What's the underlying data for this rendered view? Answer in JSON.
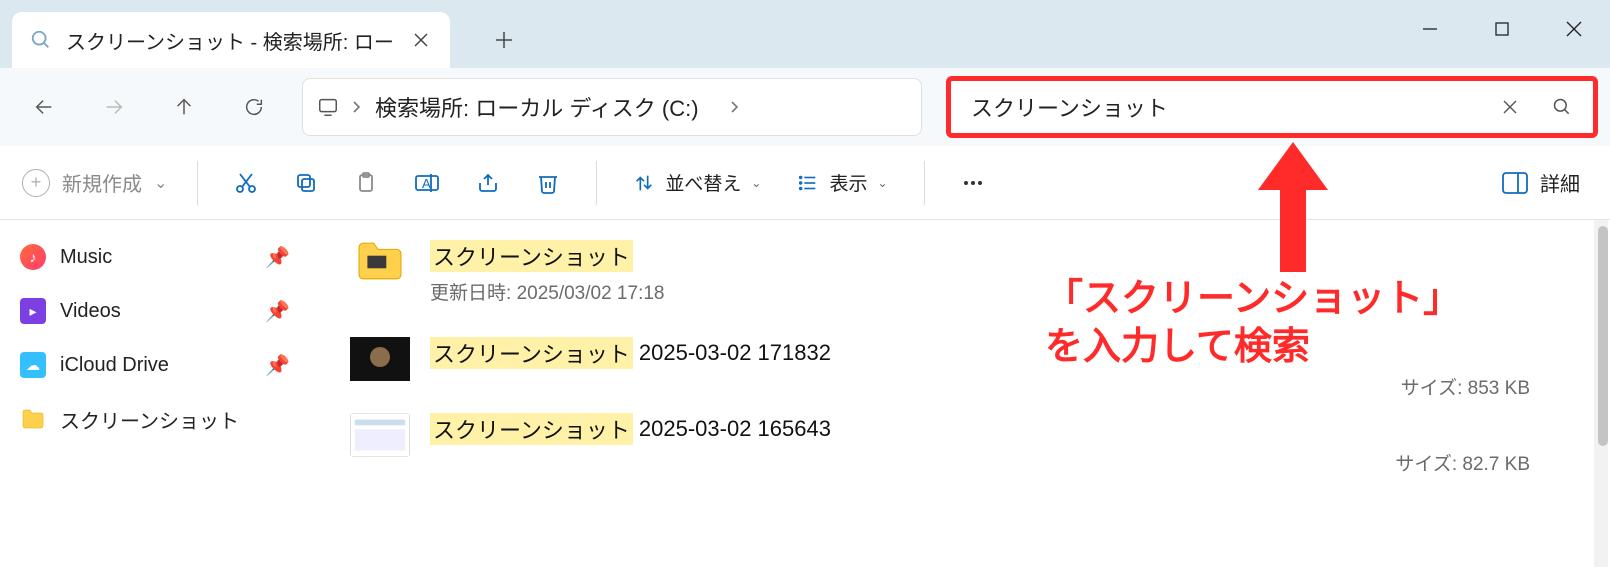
{
  "tab": {
    "title": "スクリーンショット - 検索場所: ロー"
  },
  "address": {
    "location": "検索場所: ローカル ディスク (C:)"
  },
  "search": {
    "value": "スクリーンショット"
  },
  "toolbar": {
    "new": "新規作成",
    "sort": "並べ替え",
    "view": "表示",
    "details": "詳細"
  },
  "sidebar": {
    "items": [
      {
        "label": "Music"
      },
      {
        "label": "Videos"
      },
      {
        "label": "iCloud Drive"
      },
      {
        "label": "スクリーンショット"
      }
    ]
  },
  "results": [
    {
      "highlight": "スクリーンショット",
      "suffix": "",
      "sub_label": "更新日時:",
      "sub_value": "2025/03/02 17:18",
      "size_label": "",
      "size_value": ""
    },
    {
      "highlight": "スクリーンショット",
      "suffix": " 2025-03-02 171832",
      "sub_label": "",
      "sub_value": "",
      "size_label": "サイズ:",
      "size_value": "853 KB"
    },
    {
      "highlight": "スクリーンショット",
      "suffix": " 2025-03-02 165643",
      "sub_label": "",
      "sub_value": "",
      "size_label": "サイズ:",
      "size_value": "82.7 KB"
    }
  ],
  "annotation": {
    "line1": "「スクリーンショット」",
    "line2": "を入力して検索"
  }
}
